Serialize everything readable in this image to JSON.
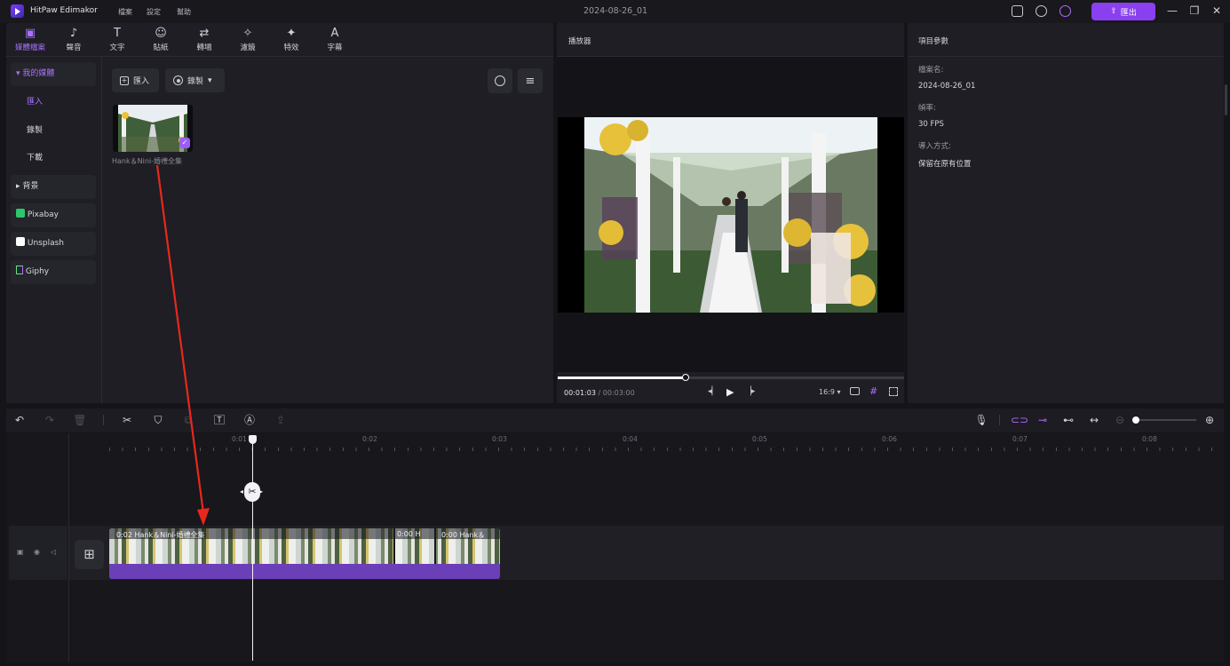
{
  "app": {
    "name": "HitPaw Edimakor",
    "menu": [
      "檔案",
      "設定",
      "幫助"
    ],
    "project_title": "2024-08-26_01",
    "export_label": "匯出"
  },
  "toolbar": {
    "tools": [
      {
        "label": "媒體檔案",
        "icon": "media-icon",
        "active": true
      },
      {
        "label": "聲音",
        "icon": "music-note-icon"
      },
      {
        "label": "文字",
        "icon": "text-icon"
      },
      {
        "label": "貼紙",
        "icon": "sticker-icon"
      },
      {
        "label": "轉場",
        "icon": "transition-icon"
      },
      {
        "label": "濾鏡",
        "icon": "filter-icon"
      },
      {
        "label": "特效",
        "icon": "effects-icon"
      },
      {
        "label": "字幕",
        "icon": "subtitle-icon"
      }
    ]
  },
  "sidebar": {
    "my_media": "我的媒體",
    "import": "匯入",
    "record": "錄製",
    "download": "下載",
    "background": "背景",
    "pixabay": "Pixabay",
    "unsplash": "Unsplash",
    "giphy": "Giphy"
  },
  "library": {
    "import_button": "匯入",
    "record_button": "錄製",
    "media_items": [
      {
        "name": "Hank＆Nini-婚禮全集"
      }
    ]
  },
  "player": {
    "title": "播放器",
    "current_time": "00:01:03",
    "separator": "/",
    "total_time": "00:03:00",
    "aspect_ratio": "16:9",
    "progress_fraction": 0.37
  },
  "project_params": {
    "title": "項目參數",
    "file_name_label": "檔案名:",
    "file_name": "2024-08-26_01",
    "frame_rate_label": "幀率:",
    "frame_rate": "30 FPS",
    "import_method_label": "導入方式:",
    "import_method": "保留在原有位置"
  },
  "timeline": {
    "ruler_labels": [
      "0:01",
      "0:02",
      "0:03",
      "0:04",
      "0:05",
      "0:06",
      "0:07",
      "0:08"
    ],
    "clips": [
      {
        "label": "0:02 Hank＆Nini-婚禮全集"
      },
      {
        "label": "0:00 H"
      },
      {
        "label": "0:00 Hank＆"
      }
    ]
  },
  "colors": {
    "accent": "#8a3ff0",
    "accent_text": "#a771ff",
    "panel_bg": "#1e1e24",
    "app_bg": "#141419",
    "clip_audio": "#6b3fb8",
    "annotation_arrow": "#e8281e"
  }
}
